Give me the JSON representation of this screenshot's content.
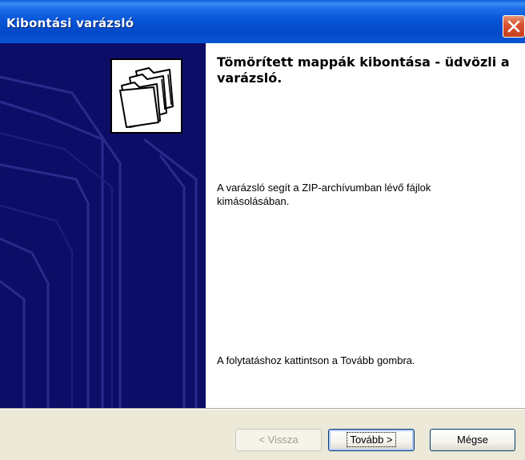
{
  "window": {
    "title": "Kibontási varázsló"
  },
  "titlebar": {
    "close_icon": "close-icon"
  },
  "side_panel": {
    "background_color": "#0d0d67",
    "icon": "folders-icon"
  },
  "content": {
    "heading": "Tömörített mappák kibontása - üdvözli a varázsló.",
    "description": "A varázsló segít a ZIP-archívumban lévő fájlok kimásolásában.",
    "continue_hint": "A folytatáshoz kattintson a Tovább gombra."
  },
  "buttons": {
    "back_label": "< Vissza",
    "next_label": "Tovább >",
    "cancel_label": "Mégse"
  },
  "colors": {
    "titlebar_blue": "#0349c8",
    "close_red": "#d9522f",
    "dialog_face": "#ece9d8"
  }
}
